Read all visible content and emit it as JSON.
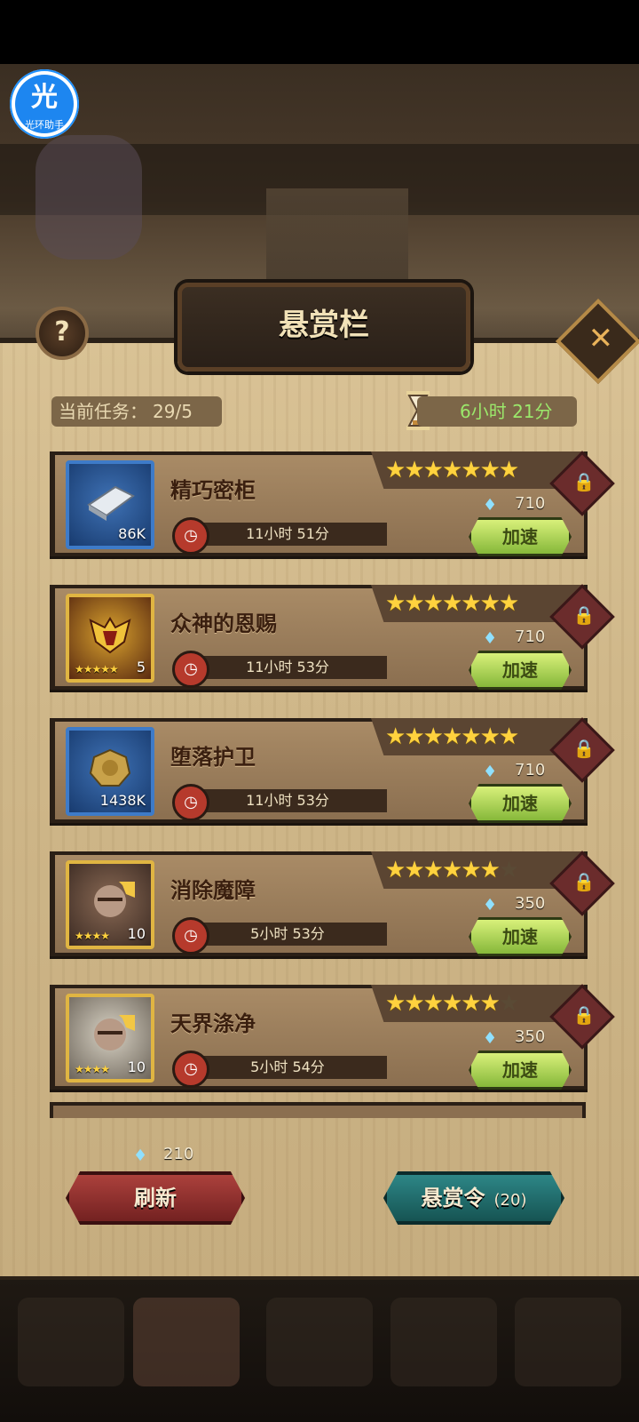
{
  "overlay": {
    "logo_char": "光",
    "logo_text": "光环助手"
  },
  "header": {
    "title": "悬赏栏",
    "help_label": "?",
    "close_label": "✕"
  },
  "status": {
    "current_tasks_label": "当前任务：",
    "current_tasks_value": "29/5",
    "time_remaining": "6小时 21分"
  },
  "bounties": [
    {
      "title": "精巧密柜",
      "icon": "silver-bar-icon",
      "icon_count": "86K",
      "icon_stars": "",
      "stars": 7,
      "max_stars": 7,
      "cost": "710",
      "timer": "11小时 51分",
      "speed_label": "加速"
    },
    {
      "title": "众神的恩赐",
      "icon": "hero-emblem-icon",
      "icon_count": "5",
      "icon_stars": "★★★★★",
      "stars": 7,
      "max_stars": 7,
      "cost": "710",
      "timer": "11小时 53分",
      "speed_label": "加速"
    },
    {
      "title": "堕落护卫",
      "icon": "gold-coin-icon",
      "icon_count": "1438K",
      "icon_stars": "",
      "stars": 7,
      "max_stars": 7,
      "cost": "710",
      "timer": "11小时 53分",
      "speed_label": "加速"
    },
    {
      "title": "消除魔障",
      "icon": "hero-portrait-icon",
      "icon_count": "10",
      "icon_stars": "★★★★",
      "stars": 6,
      "max_stars": 7,
      "cost": "350",
      "timer": "5小时 53分",
      "speed_label": "加速"
    },
    {
      "title": "天界涤净",
      "icon": "hero-portrait-icon",
      "icon_count": "10",
      "icon_stars": "★★★★",
      "stars": 6,
      "max_stars": 7,
      "cost": "350",
      "timer": "5小时 54分",
      "speed_label": "加速"
    }
  ],
  "footer": {
    "refresh_cost": "210",
    "refresh_label": "刷新",
    "bounty_order_label": "悬赏令",
    "bounty_order_count": "(20)"
  },
  "colors": {
    "gold_star": "#ffd23e",
    "speed_green": "#9be86b",
    "refresh_red": "#8f2a28",
    "bounty_teal": "#1f6f6e"
  }
}
